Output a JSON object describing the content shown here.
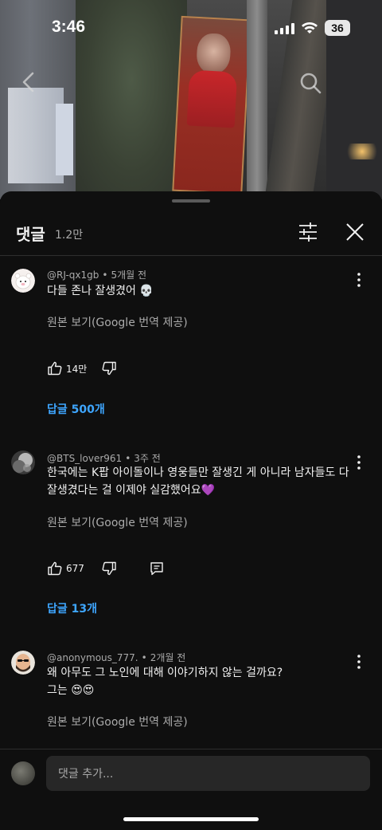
{
  "status_bar": {
    "time": "3:46",
    "battery": "36",
    "icons": [
      "cellular-signal-icon",
      "wifi-icon",
      "battery-icon"
    ]
  },
  "video_overlay": {
    "icons": [
      "back-icon",
      "search-icon"
    ]
  },
  "comments_panel": {
    "title": "댓글",
    "count": "1.2만",
    "icons": [
      "filter-icon",
      "close-icon"
    ]
  },
  "comments": [
    {
      "author": "@RJ-qx1gb",
      "time": "5개월 전",
      "text": "다들 존나 잘생겼어 💀",
      "translate_label": "원본 보기(Google 번역 제공)",
      "likes": "14만",
      "replies_label": "답글 500개"
    },
    {
      "author": "@BTS_lover961",
      "time": "3주 전",
      "text": "한국에는 K팝 아이돌이나 영웅들만 잘생긴 게 아니라 남자들도 다 잘생겼다는 걸 이제야 실감했어요💜",
      "translate_label": "원본 보기(Google 번역 제공)",
      "likes": "677",
      "replies_label": "답글 13개"
    },
    {
      "author": "@anonymous_777.",
      "time": "2개월 전",
      "text_line1": "왜 아무도 그 노인에 대해 이야기하지 않는 걸까요?",
      "text_line2": "그는 😍😍",
      "translate_label": "원본 보기(Google 번역 제공)"
    }
  ],
  "composer": {
    "placeholder": "댓글 추가..."
  },
  "colors": {
    "background": "#0f0f0f",
    "text_primary": "#f1f1f1",
    "text_secondary": "#aaaaaa",
    "link_blue": "#3ea6ff",
    "input_bg": "#272727"
  }
}
